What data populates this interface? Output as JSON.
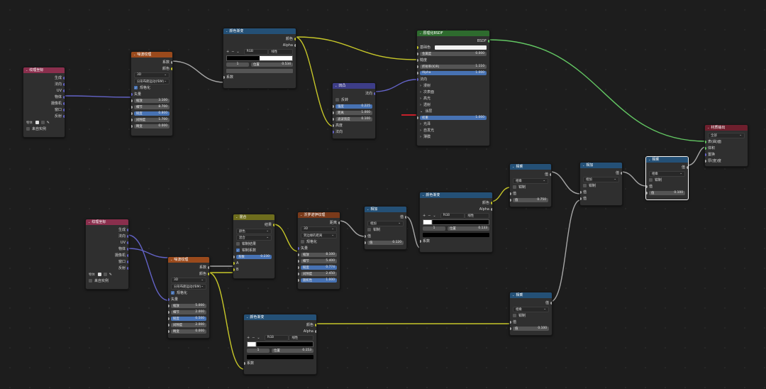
{
  "colors": {
    "wire_gray": "#a7a7a7",
    "wire_yellow": "#c7c729",
    "wire_purple": "#6363c7",
    "wire_green": "#63c763",
    "wire_red": "#c7202a"
  },
  "nodes": {
    "texcoord1": {
      "title": "纹理坐标",
      "outputs": [
        "生成",
        "法向",
        "UV",
        "物体",
        "摄像机",
        "窗口",
        "反射"
      ],
      "object_label": "物体",
      "from_instancer": "来自实例"
    },
    "noise1": {
      "title": "噪波纹理",
      "outputs": [
        "系数",
        "颜色"
      ],
      "dim": "3D",
      "normalize": "规格化",
      "fbm": "分形布朗运动(fBM)",
      "vector": "矢量",
      "fields": [
        {
          "label": "缩放",
          "value": "3.100"
        },
        {
          "label": "细节",
          "value": "8.700"
        },
        {
          "label": "糙度",
          "value": "0.800",
          "blue": true
        },
        {
          "label": "间隙度",
          "value": "1.700"
        },
        {
          "label": "畸变",
          "value": "0.000"
        }
      ]
    },
    "ramp1": {
      "title": "颜色渐变",
      "outputs": [
        "颜色",
        "Alpha"
      ],
      "mode": "RGB",
      "interp": "线性",
      "stop_index": "1",
      "pos_label": "位置",
      "pos_value": "0.534",
      "input": "系数"
    },
    "bump": {
      "title": "凹凸",
      "output": "法向",
      "invert": "反转",
      "fields": [
        {
          "label": "强度",
          "value": "0.225",
          "blue": true
        },
        {
          "label": "距离",
          "value": "1.000"
        },
        {
          "label": "滤波宽度",
          "value": "0.100"
        }
      ],
      "inputs": [
        "高度",
        "法向"
      ]
    },
    "bsdf": {
      "title": "原理化BSDF",
      "output": "BSDF",
      "rows": [
        "基础色",
        "金属度",
        "糙度",
        "IOR",
        "Alpha",
        "法向",
        "漫射",
        "次表面",
        "高光",
        "透射",
        "涂层",
        "光泽",
        "自发光",
        "薄膜"
      ],
      "metal_value": "0.000",
      "ior_label": "折射率(IOR)",
      "ior_value": "1.110",
      "alpha_value": "1.000",
      "coat_label": "权重",
      "coat_value": "1.000"
    },
    "out": {
      "title": "材质输出",
      "target": "全部",
      "inputs": [
        "表(曲)面",
        "体积",
        "置换",
        "厚(度)度"
      ]
    },
    "mathA": {
      "title": "相乘",
      "output": "值",
      "op": "相乘",
      "clamp": "钳制",
      "in": "值",
      "value_label": "值",
      "value": "0.750"
    },
    "mathB": {
      "title": "相加",
      "output": "值",
      "op": "相加",
      "clamp": "钳制",
      "in1": "值",
      "in2": "值"
    },
    "mathC": {
      "title": "相乘",
      "output": "值",
      "op": "相乘",
      "clamp": "钳制",
      "in": "值",
      "value_label": "值",
      "value": "0.100"
    },
    "texcoord2": {
      "title": "纹理坐标",
      "outputs": [
        "生成",
        "法向",
        "UV",
        "物体",
        "摄像机",
        "窗口",
        "反射"
      ],
      "object_label": "物体",
      "from_instancer": "来自实例"
    },
    "mix": {
      "title": "混合",
      "output": "结果",
      "type": "颜色",
      "blend": "混合",
      "clamp_result": "钳制结果",
      "clamp_factor": "钳制系数",
      "factor_label": "系数",
      "factor": "0.230",
      "inA": "A",
      "inB": "B"
    },
    "noise2": {
      "title": "噪波纹理",
      "outputs": [
        "系数",
        "颜色"
      ],
      "dim": "3D",
      "normalize": "规格化",
      "fbm": "分形布朗运动(fBM)",
      "vector": "矢量",
      "fields": [
        {
          "label": "缩放",
          "value": "5.000"
        },
        {
          "label": "细节",
          "value": "2.000"
        },
        {
          "label": "糙度",
          "value": "0.500",
          "blue": true
        },
        {
          "label": "间隙度",
          "value": "2.000"
        },
        {
          "label": "畸变",
          "value": "0.000"
        }
      ]
    },
    "voronoi": {
      "title": "沃罗诺伊纹理",
      "output": "距离",
      "dim": "3D",
      "feature": "到边缘的距离",
      "normalize": "规格化",
      "vector": "矢量",
      "fields": [
        {
          "label": "缩放",
          "value": "8.100"
        },
        {
          "label": "细节",
          "value": "5.400"
        },
        {
          "label": "糙度",
          "value": "0.774",
          "blue": true
        },
        {
          "label": "间隙度",
          "value": "2.450"
        },
        {
          "label": "随机性",
          "value": "1.000",
          "blue": true
        }
      ]
    },
    "mathD": {
      "title": "相加",
      "output": "值",
      "op": "相加",
      "clamp": "钳制",
      "in": "值",
      "value_label": "值",
      "value": "0.120"
    },
    "ramp2": {
      "title": "颜色渐变",
      "outputs": [
        "颜色",
        "Alpha"
      ],
      "mode": "RGB",
      "interp": "线性",
      "stop_index": "1",
      "pos_label": "位置",
      "pos_value": "0.133",
      "input": "系数"
    },
    "ramp3": {
      "title": "颜色渐变",
      "outputs": [
        "颜色",
        "Alpha"
      ],
      "mode": "RGB",
      "interp": "线性",
      "stop_index": "1",
      "pos_label": "位置",
      "pos_value": "0.153",
      "input": "系数"
    },
    "mathE": {
      "title": "相乘",
      "output": "值",
      "op": "相乘",
      "clamp": "钳制",
      "in": "值",
      "value_label": "值",
      "value": "0.100"
    }
  }
}
